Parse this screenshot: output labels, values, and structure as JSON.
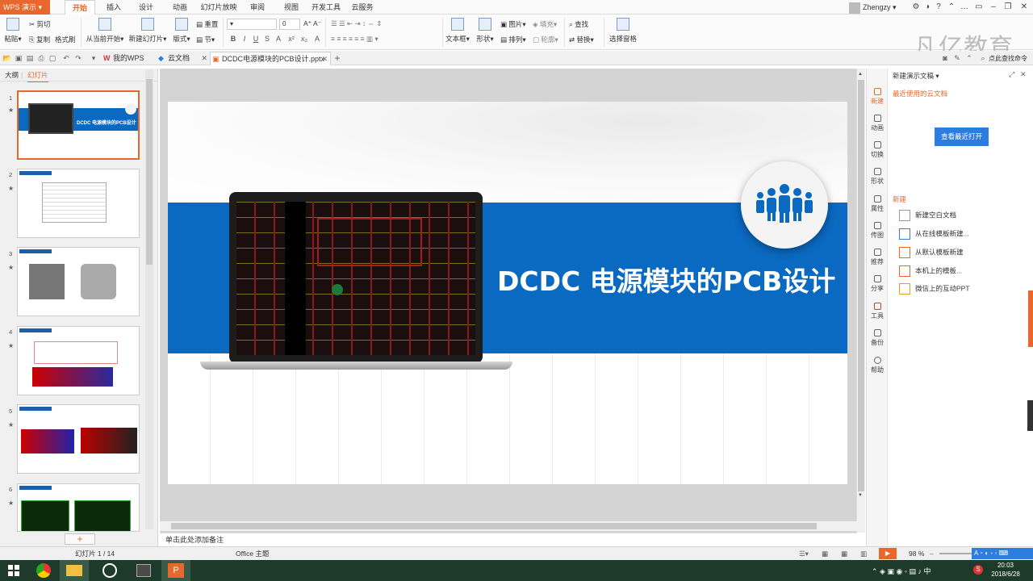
{
  "app": {
    "name": "WPS 演示",
    "ribbon_tabs": [
      "开始",
      "插入",
      "设计",
      "动画",
      "幻灯片放映",
      "审阅",
      "视图",
      "开发工具",
      "云服务"
    ],
    "user": "Zhengzy",
    "brand_watermark": "凡亿教育"
  },
  "ribbon": {
    "paste": "粘贴",
    "cut": "剪切",
    "copy": "复制",
    "format_painter": "格式刷",
    "from_current": "从当前开始",
    "new_slide": "新建幻灯片",
    "layout": "版式",
    "reset": "重置",
    "section": "节",
    "font_size": "0",
    "bold": "B",
    "italic": "I",
    "underline": "U",
    "strike": "S",
    "textbox": "文本框",
    "shape": "形状",
    "picture": "图片",
    "fill": "填充",
    "arrange": "排列",
    "outline": "轮廓",
    "find": "查找",
    "replace": "替换",
    "select_pane": "选择窗格"
  },
  "doc_tabs": {
    "my_wps": "我的WPS",
    "cloud": "云文档",
    "current": "DCDC电源模块的PCB设计.pptx",
    "search_help": "点此查找命令"
  },
  "left_panel": {
    "tab_outline": "大纲",
    "tab_slides": "幻灯片",
    "slides": [
      {
        "num": "1",
        "title": "DCDC 电源模块的PCB设计"
      },
      {
        "num": "2"
      },
      {
        "num": "3"
      },
      {
        "num": "4"
      },
      {
        "num": "5"
      },
      {
        "num": "6"
      }
    ],
    "add": "+"
  },
  "slide": {
    "title": "DCDC 电源模块的PCB设计"
  },
  "notes_placeholder": "单击此处添加备注",
  "sidebar": [
    "新建",
    "动画",
    "切换",
    "形状",
    "属性",
    "传图",
    "推荐",
    "分享",
    "工具",
    "备份",
    "帮助"
  ],
  "task_pane": {
    "header": "新建演示文稿",
    "recent_title": "最近使用的云文档",
    "open_recent": "查看最近打开",
    "new_section": "新建",
    "items": [
      "新建空白文档",
      "从在线模板新建...",
      "从默认模板新建",
      "本机上的模板...",
      "微信上的互动PPT"
    ]
  },
  "status": {
    "slide_counter": "幻灯片 1 / 14",
    "theme": "Office 主题",
    "zoom": "98 %"
  },
  "taskbar": {
    "time": "20:03",
    "date": "2018/6/28"
  }
}
